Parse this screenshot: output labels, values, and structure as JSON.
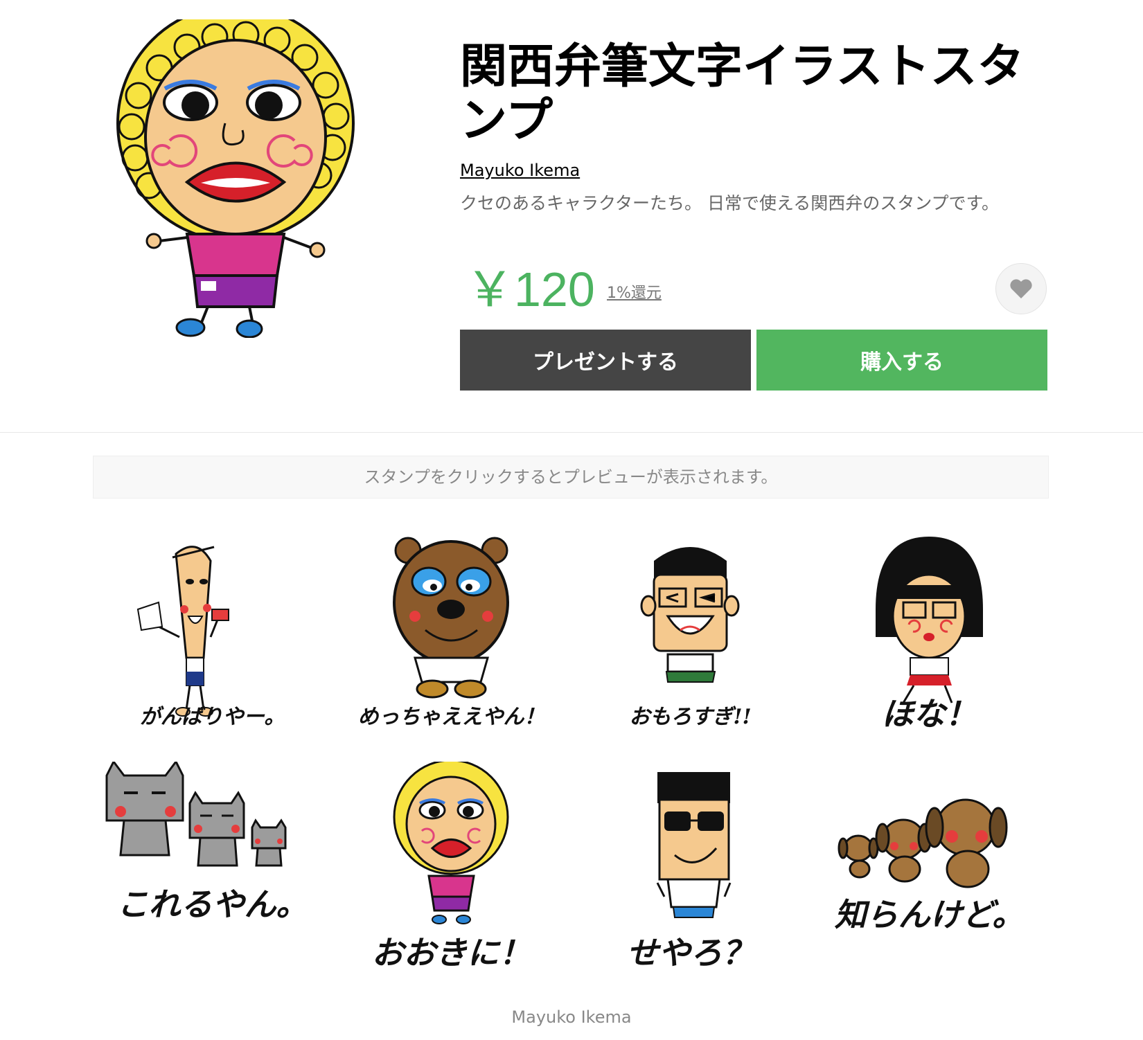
{
  "product": {
    "title": "関西弁筆文字イラストスタンプ",
    "author": "Mayuko Ikema",
    "description": "クセのあるキャラクターたち。 日常で使える関西弁のスタンプです。",
    "price": "￥120",
    "point_link": "1%還元",
    "present_button": "プレゼントする",
    "buy_button": "購入する",
    "favorite_icon": "heart-icon"
  },
  "notice": "スタンプをクリックするとプレビューが表示されます。",
  "stickers": [
    {
      "caption": "がんばりやー。",
      "character": "tall-man-flags"
    },
    {
      "caption": "めっちゃええやん！",
      "character": "brown-bear"
    },
    {
      "caption": "おもろすぎ!!",
      "character": "glasses-man-laughing"
    },
    {
      "caption": "ほな！",
      "character": "bob-hair-girl"
    },
    {
      "caption": "これるやん。",
      "character": "grey-cats"
    },
    {
      "caption": "おおきに！",
      "character": "curly-lady"
    },
    {
      "caption": "せやろ？",
      "character": "sunglasses-man"
    },
    {
      "caption": "知らんけど。",
      "character": "brown-dogs"
    }
  ],
  "footer": "Mayuko Ikema",
  "colors": {
    "accent_green": "#52b65f",
    "price_green": "#4cb360",
    "present_gray": "#454545"
  }
}
